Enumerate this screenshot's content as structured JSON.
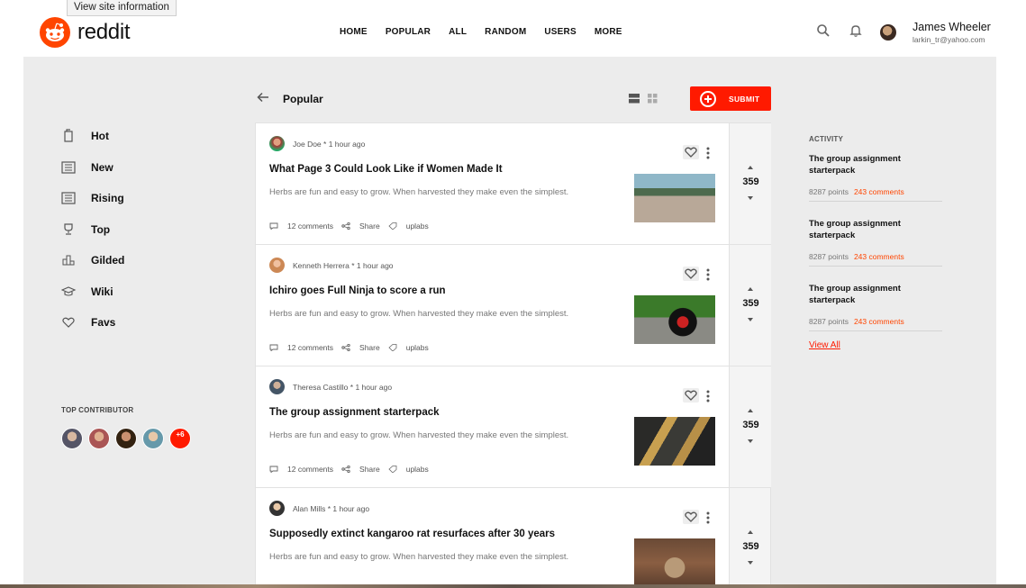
{
  "tooltip": "View site information",
  "brand": {
    "name": "reddit",
    "color": "#ff4500"
  },
  "nav": [
    "HOME",
    "POPULAR",
    "ALL",
    "RANDOM",
    "USERS",
    "MORE"
  ],
  "header_icons": [
    "search-icon",
    "bell-icon"
  ],
  "user": {
    "name": "James Wheeler",
    "email": "larkin_tr@yahoo.com"
  },
  "sidebar": {
    "items": [
      {
        "label": "Hot",
        "icon": "fire-icon"
      },
      {
        "label": "New",
        "icon": "newspaper-icon"
      },
      {
        "label": "Rising",
        "icon": "newspaper-icon"
      },
      {
        "label": "Top",
        "icon": "trophy-icon"
      },
      {
        "label": "Gilded",
        "icon": "podium-icon"
      },
      {
        "label": "Wiki",
        "icon": "graduation-cap-icon"
      },
      {
        "label": "Favs",
        "icon": "heart-icon"
      }
    ],
    "top_contributor_label": "TOP CONTRIBUTOR",
    "more_count": "+6"
  },
  "feed": {
    "title": "Popular",
    "submit_label": "SUBMIT",
    "posts": [
      {
        "author": "Joe Doe",
        "time": "1 hour ago",
        "title": "What Page 3 Could Look Like if Women Made It",
        "excerpt": "Herbs are fun and easy to grow. When harvested they make even the simplest.",
        "comments": "12 comments",
        "share": "Share",
        "tag": "uplabs",
        "votes": "359"
      },
      {
        "author": "Kenneth Herrera",
        "time": "1 hour ago",
        "title": "Ichiro goes Full Ninja to score a run",
        "excerpt": "Herbs are fun and easy to grow. When harvested they make even the simplest.",
        "comments": "12 comments",
        "share": "Share",
        "tag": "uplabs",
        "votes": "359"
      },
      {
        "author": "Theresa Castillo",
        "time": "1 hour ago",
        "title": "The group assignment starterpack",
        "excerpt": "Herbs are fun and easy to grow. When harvested they make even the simplest.",
        "comments": "12 comments",
        "share": "Share",
        "tag": "uplabs",
        "votes": "359"
      },
      {
        "author": "Alan Mills",
        "time": "1 hour ago",
        "title": "Supposedly extinct kangaroo rat resurfaces after 30 years",
        "excerpt": "Herbs are fun and easy to grow. When harvested they make even the simplest.",
        "comments": "",
        "share": "",
        "tag": "",
        "votes": "359"
      }
    ]
  },
  "activity": {
    "heading": "ACTIVITY",
    "items": [
      {
        "title": "The group assignment starterpack",
        "points": "8287 points",
        "comments": "243 comments"
      },
      {
        "title": "The group assignment starterpack",
        "points": "8287 points",
        "comments": "243 comments"
      },
      {
        "title": "The group assignment starterpack",
        "points": "8287 points",
        "comments": "243 comments"
      }
    ],
    "view_all": "View All"
  }
}
